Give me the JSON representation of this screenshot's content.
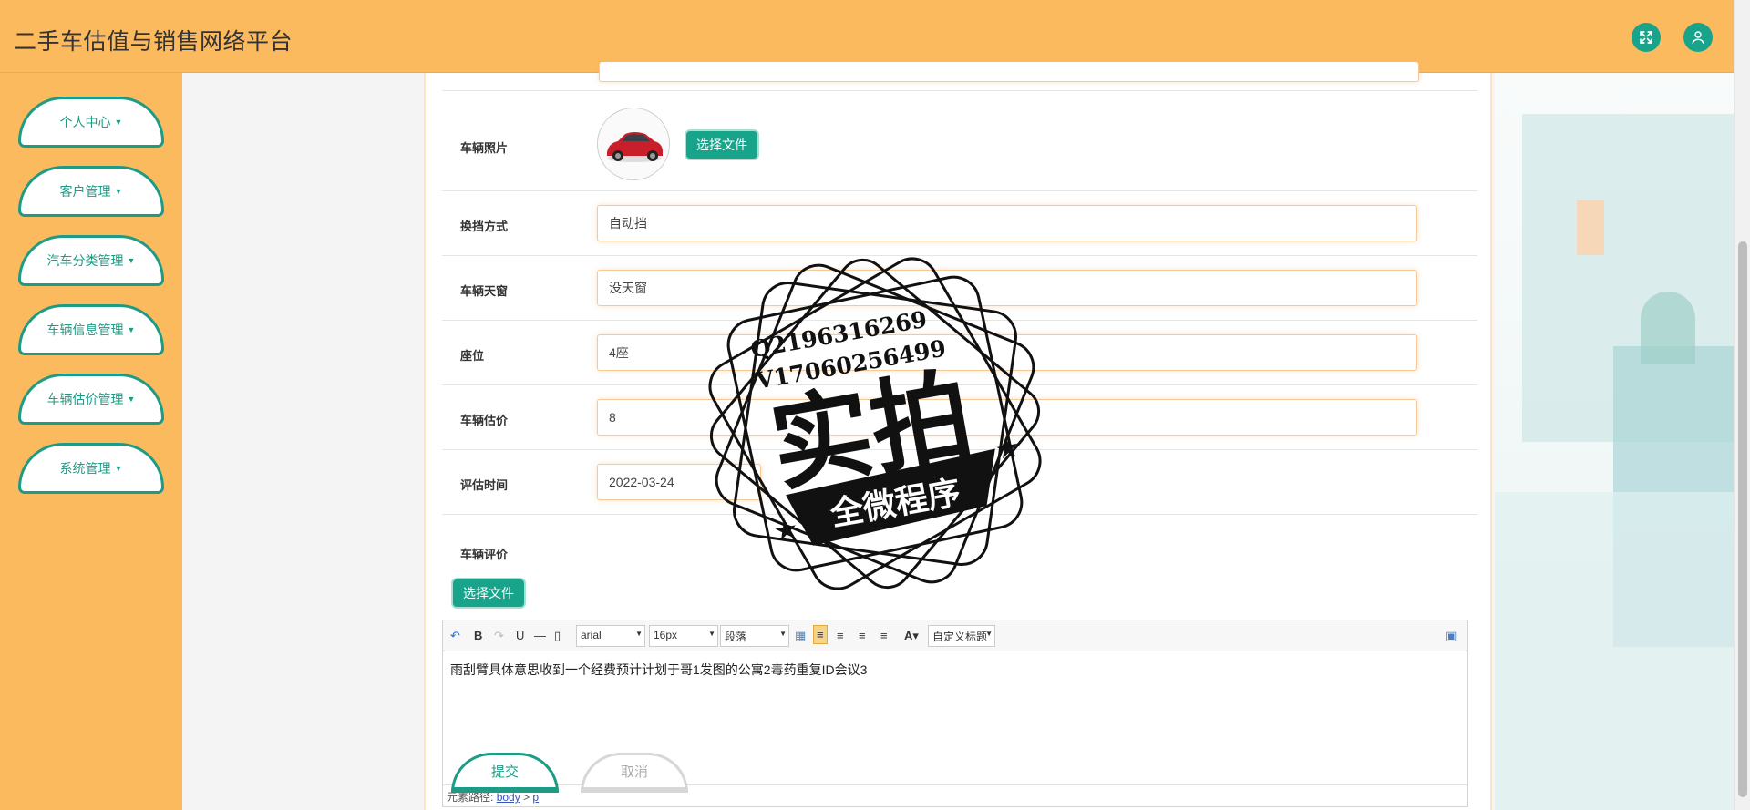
{
  "header": {
    "title": "二手车估值与销售网络平台",
    "fullscreen_icon": "fullscreen-icon",
    "user_icon": "user-icon",
    "accent": "#18a38b",
    "bg": "#fcba5f"
  },
  "sidebar": {
    "items": [
      {
        "label": "个人中心"
      },
      {
        "label": "客户管理"
      },
      {
        "label": "汽车分类管理"
      },
      {
        "label": "车辆信息管理"
      },
      {
        "label": "车辆估价管理"
      },
      {
        "label": "系统管理"
      }
    ]
  },
  "form": {
    "photo_label": "车辆照片",
    "file_button": "选择文件",
    "transmission_label": "换挡方式",
    "transmission_value": "自动挡",
    "sunroof_label": "车辆天窗",
    "sunroof_value": "没天窗",
    "seats_label": "座位",
    "seats_value": "4座",
    "valuation_label": "车辆估价",
    "valuation_value": "8",
    "eval_time_label": "评估时间",
    "eval_time_value": "2022-03-24",
    "review_label": "车辆评价",
    "review_file_button": "选择文件"
  },
  "editor": {
    "font_family": "arial",
    "font_size": "16px",
    "paragraph": "段落",
    "custom_title": "自定义标题",
    "content": "雨刮臂具体意思收到一个经费预计计划于哥1发图的公寓2毒药重复ID会议3",
    "path_label": "元素路径:",
    "path_body": "body",
    "path_sep": ">",
    "path_p": "p"
  },
  "actions": {
    "submit": "提交",
    "cancel": "取消"
  },
  "watermark": {
    "line1": "Q2196316269",
    "line2": "V17060256499",
    "main": "实拍",
    "banner": "全微程序"
  }
}
